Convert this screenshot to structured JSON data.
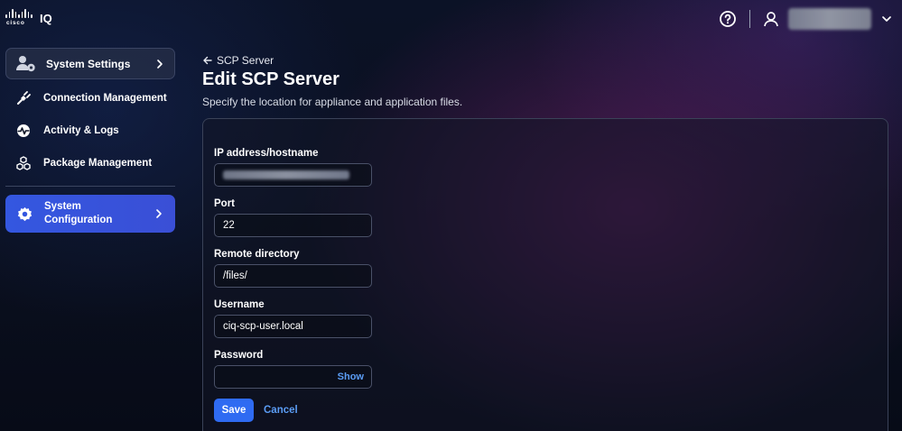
{
  "header": {
    "brand_word": "cisco",
    "product": "IQ",
    "help_icon": "help-circle-icon",
    "user_icon": "user-icon",
    "menu_icon": "chevron-down-icon"
  },
  "sidebar": {
    "settings_card": {
      "label": "System Settings",
      "icon": "user-gear-icon"
    },
    "items": [
      {
        "label": "Connection Management",
        "icon": "plug-icon"
      },
      {
        "label": "Activity & Logs",
        "icon": "activity-icon"
      },
      {
        "label": "Package Management",
        "icon": "packages-icon"
      }
    ],
    "active": {
      "label": "System Configuration",
      "icon": "gear-icon"
    }
  },
  "main": {
    "back_label": "SCP Server",
    "title": "Edit SCP Server",
    "subtitle": "Specify the location for appliance and application files.",
    "form": {
      "ip_label": "IP address/hostname",
      "ip_value": "",
      "port_label": "Port",
      "port_value": "22",
      "remote_dir_label": "Remote directory",
      "remote_dir_value": "/files/",
      "username_label": "Username",
      "username_value": "ciq-scp-user.local",
      "password_label": "Password",
      "password_value": "",
      "show_label": "Show",
      "save_label": "Save",
      "cancel_label": "Cancel"
    }
  },
  "colors": {
    "accent": "#2f6bf2",
    "link": "#5b9df5",
    "active_nav": "#3457e0"
  }
}
